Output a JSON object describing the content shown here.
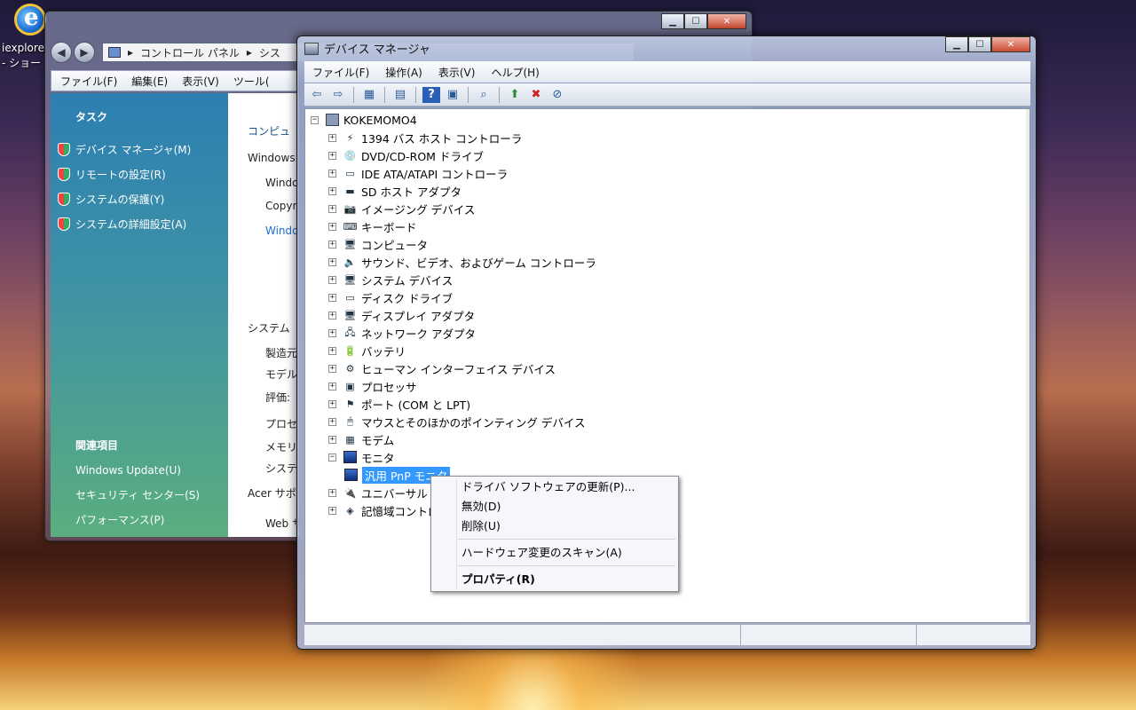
{
  "desktop": {
    "icon_label_1": "iexplore",
    "icon_label_2": "- ショー"
  },
  "control_panel": {
    "address": [
      "コントロール パネル",
      "シス"
    ],
    "menu": [
      "ファイル(F)",
      "編集(E)",
      "表示(V)",
      "ツール("
    ],
    "tasks_title": "タスク",
    "tasks": [
      "デバイス マネージャ(M)",
      "リモートの設定(R)",
      "システムの保護(Y)",
      "システムの詳細設定(A)"
    ],
    "related_title": "関連項目",
    "related": [
      "Windows Update(U)",
      "セキュリティ センター(S)",
      "パフォーマンス(P)"
    ],
    "main_fragments": [
      "コンピュ",
      "Windows",
      "Windo",
      "Copyr",
      "Windo",
      "システム",
      "製造元",
      "モデル",
      "評価:",
      "プロセ",
      "メモリ",
      "システ",
      "Acer サポ",
      "Web サ"
    ]
  },
  "device_manager": {
    "title": "デバイス マネージャ",
    "menu": [
      "ファイル(F)",
      "操作(A)",
      "表示(V)",
      "ヘルプ(H)"
    ],
    "root": "KOKEMOMO4",
    "items": [
      "1394 バス ホスト コントローラ",
      "DVD/CD-ROM ドライブ",
      "IDE ATA/ATAPI コントローラ",
      "SD ホスト アダプタ",
      "イメージング デバイス",
      "キーボード",
      "コンピュータ",
      "サウンド、ビデオ、およびゲーム コントローラ",
      "システム デバイス",
      "ディスク ドライブ",
      "ディスプレイ アダプタ",
      "ネットワーク アダプタ",
      "バッテリ",
      "ヒューマン インターフェイス デバイス",
      "プロセッサ",
      "ポート (COM と LPT)",
      "マウスとそのほかのポインティング デバイス",
      "モデム",
      "モニタ"
    ],
    "child_item": "汎用 PnP モニタ",
    "after_items": [
      "ユニバーサル シ",
      "記憶域コントロ"
    ]
  },
  "context_menu": {
    "update_driver": "ドライバ ソフトウェアの更新(P)...",
    "disable": "無効(D)",
    "uninstall": "削除(U)",
    "scan": "ハードウェア変更のスキャン(A)",
    "properties": "プロパティ(R)"
  }
}
